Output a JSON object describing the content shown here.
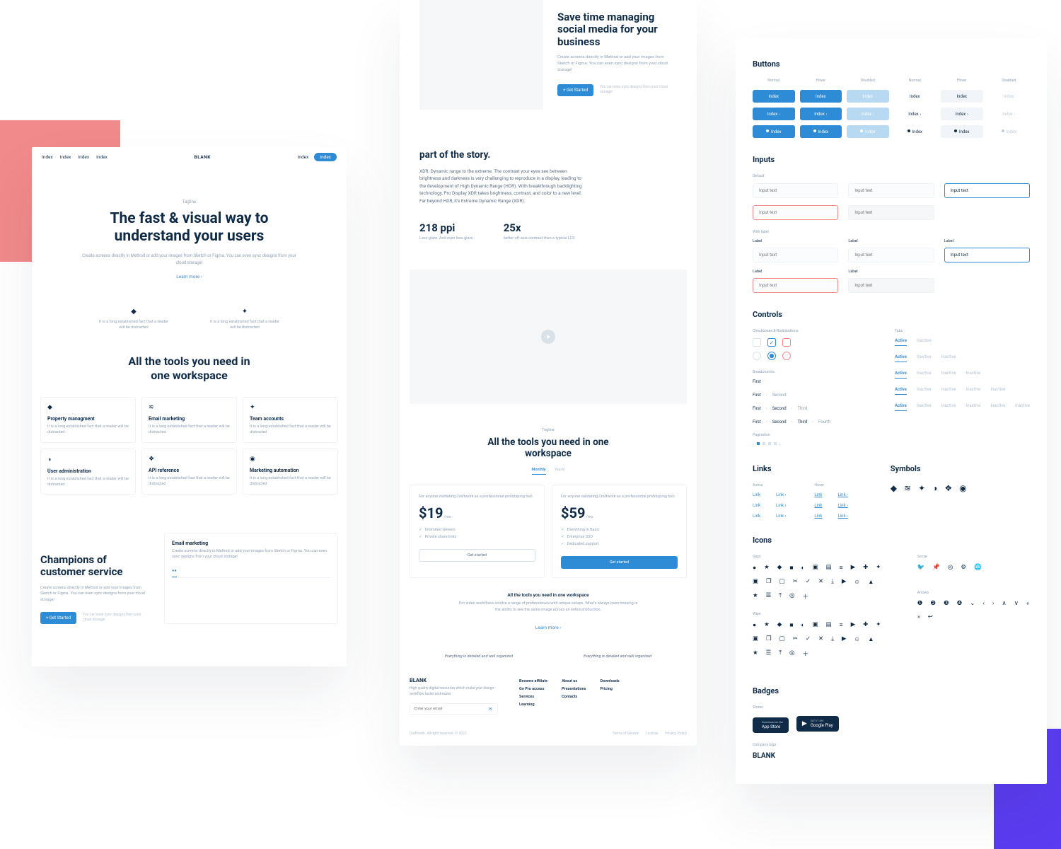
{
  "left": {
    "nav": [
      "Index",
      "Index",
      "Index",
      "Index"
    ],
    "logo": "BLANK",
    "navRight": "Index",
    "navBtn": "Index",
    "tagline": "Tagline",
    "h1a": "The fast & visual way to",
    "h1b": "understand your users",
    "sub": "Create screens directly in Method or add your images from Sketch or Figma. You can even sync designs from your cloud storage!",
    "learn": "Learn more ›",
    "featText": "It is a long established fact that a reader will be distracted",
    "toolsH": "All the tools you need in\none workspace",
    "cards": [
      {
        "icon": "◆",
        "title": "Property managment"
      },
      {
        "icon": "≋",
        "title": "Email marketing"
      },
      {
        "icon": "✦",
        "title": "Team accounts"
      },
      {
        "icon": "◑",
        "title": "User administration"
      },
      {
        "icon": "❖",
        "title": "API reference"
      },
      {
        "icon": "◉",
        "title": "Marketing automation"
      }
    ],
    "cardDesc": "It is a long established fact that a reader will be distracted",
    "champ": {
      "h": "Champions of customer service",
      "p": "Create screens directly in Method or add your images from Sketch or Figma. You can even sync designs from your cloud storage!",
      "btn": "+ Get Started",
      "note": "You can even sync designs from your cloud storage!",
      "panelTitle": "Email marketing",
      "panelDesc": "Create screens directly in Method or add your images from Sketch or Figma. You can even sync designs from your cloud storage!"
    }
  },
  "center": {
    "hero": {
      "h": "Save time managing social media for your business",
      "p": "Create screens directly in Method or add your images from Sketch or Figma. You can even sync designs from your cloud storage!",
      "btn": "+ Get Started",
      "note": "You can even sync designs from your cloud storage!"
    },
    "story": {
      "h": "part of the story.",
      "body": "XDR. Dynamic range to the extreme. The contrast your eyes see between brightness and darkness is very challenging to reproduce in a display, leading to the development of High Dynamic Range (HDR). With breakthrough backlighting technology, Pro Display XDR takes brightness, contrast, and color to a new level. Far beyond HDR, it's Extreme Dynamic Range (XDR).",
      "stats": [
        {
          "n": "218 ppi",
          "t": "Less glare.\nAnd even less glare."
        },
        {
          "n": "25x",
          "t": "better off-axis contrast\nthan a typical LCD"
        }
      ]
    },
    "price": {
      "tag": "Tagline",
      "h": "All the tools you need in one workspace",
      "tabs": [
        "Monthly",
        "Yearly"
      ],
      "planDesc": "For anyone validating Craftwork as a professional prototyping tool.",
      "plans": [
        {
          "p": "$19",
          "per": "/mo",
          "items": [
            "Unlimited viewers",
            "Private share links"
          ],
          "btn": "Get started"
        },
        {
          "p": "$59",
          "per": "/mo",
          "items": [
            "Everything in Basic",
            "Enterprise SSO",
            "Dedicated support"
          ],
          "btn": "Get started"
        }
      ],
      "foot": {
        "t": "All the tools you need in one workspace",
        "d": "Pro video workflows involve a range of professionals with unique setups. What's always been missing is the ability to see the same image across an entire production.",
        "learn": "Learn more ›"
      },
      "testi": "Everything is detailed and well organized"
    },
    "footer": {
      "logo": "BLANK",
      "desc": "High quality digital resources which make your design workflow faster and easier",
      "placeholder": "Enter your email",
      "cols": [
        [
          "Become affiliate",
          "Go Pro access",
          "Services",
          "Learning"
        ],
        [
          "About us",
          "Presentations",
          "Contacts"
        ],
        [
          "Downloads",
          "Pricing"
        ]
      ],
      "copy": "Craftwork. All right reserved. © 2022",
      "legal": [
        "Terms of Service",
        "License",
        "Privacy Policy"
      ]
    }
  },
  "right": {
    "buttons": {
      "h": "Buttons",
      "cols": [
        "Normal",
        "Hover",
        "Disabled",
        "Normal",
        "Hover",
        "Disabled"
      ],
      "label": "Index"
    },
    "inputs": {
      "h": "Inputs",
      "sh1": "Default",
      "sh2": "With label",
      "ph": "Input text",
      "lbl": "Label"
    },
    "controls": {
      "h": "Controls",
      "sh1": "Checkboxes & Radiobuttons",
      "sh2": "Tabs",
      "sh3": "Breadcrumbs",
      "sh4": "Pagination",
      "tabA": "Active",
      "tabI": "Inactive",
      "bc": [
        "First",
        "Second",
        "Third",
        "Fourth"
      ]
    },
    "links": {
      "h": "Links",
      "sh1": "Active",
      "sh2": "Hover",
      "link": "Link",
      "linkA": "Link ›",
      "symH": "Symbols"
    },
    "icons": {
      "h": "Icons",
      "sh1": "Glips",
      "sh2": "Social",
      "sh3": "Wipe",
      "sh4": "Arrows",
      "g": [
        "●",
        "★",
        "◆",
        "■",
        "◐",
        "▣",
        "▤",
        "≡",
        "▶",
        "✚",
        "✦",
        "▣",
        "❐",
        "▢",
        "✂",
        "✓",
        "✕",
        "⤓",
        "▶",
        "☺",
        "▲",
        "★",
        "☰",
        "⤒",
        "◎",
        "＋"
      ],
      "s": [
        "🐦",
        "📌",
        "◎",
        "⚙",
        "🌐"
      ],
      "a": [
        "❶",
        "❷",
        "❸",
        "❹",
        "⌄",
        "‹",
        "›",
        "∧",
        "∨",
        "«",
        "»",
        "↩"
      ]
    },
    "badges": {
      "h": "Badges",
      "sh1": "Stores",
      "sh2": "Company logo",
      "app": {
        "s": "Download on the",
        "b": "App Store"
      },
      "gp": {
        "s": "GET IT ON",
        "b": "Google Play"
      },
      "logo": "BLANK"
    }
  }
}
